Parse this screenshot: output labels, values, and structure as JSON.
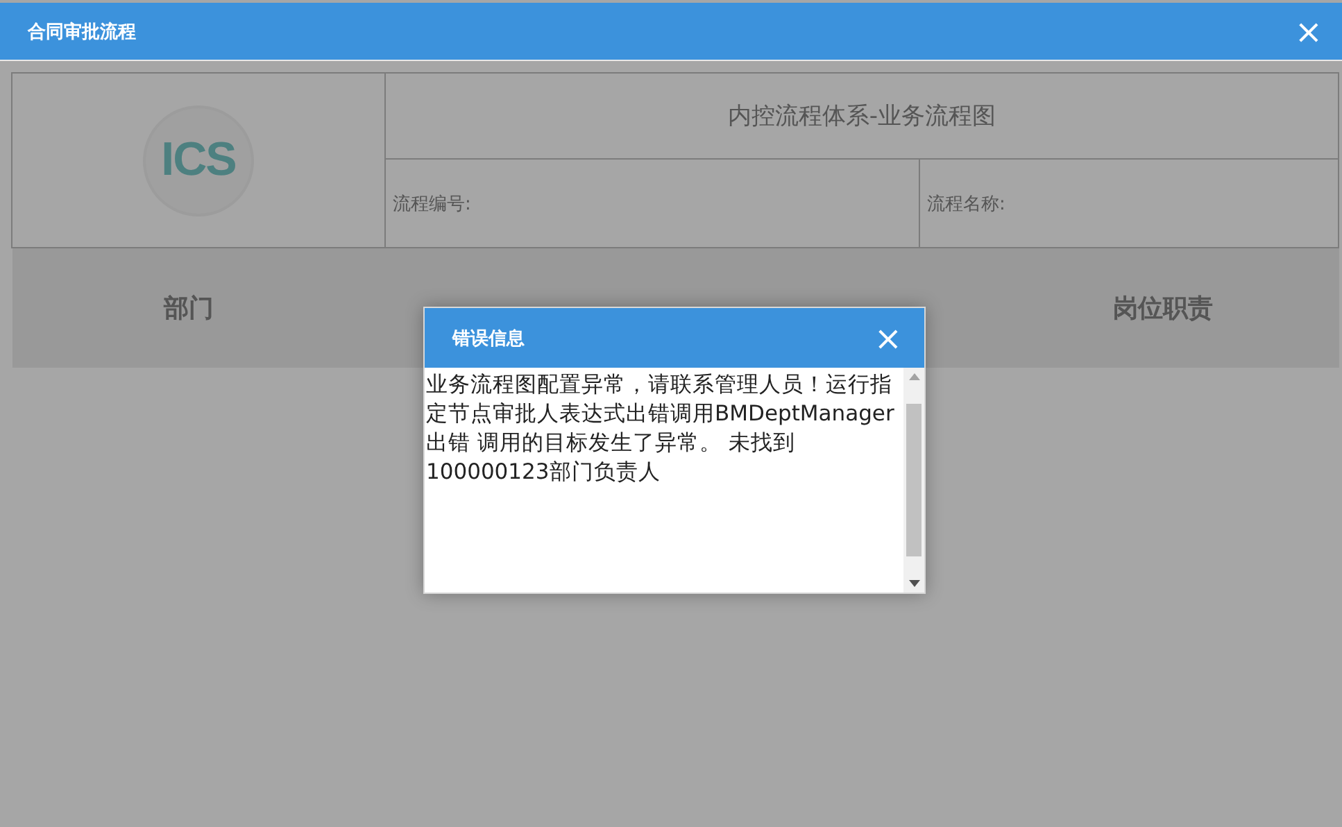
{
  "window": {
    "title": "合同审批流程",
    "close": "×"
  },
  "header": {
    "logo": "ICS",
    "title": "内控流程体系-业务流程图",
    "fields": [
      {
        "label": "流程编号:"
      },
      {
        "label": "流程名称:"
      }
    ]
  },
  "columns": [
    "部门",
    "岗位职责"
  ],
  "dialog": {
    "title": "错误信息",
    "close": "×",
    "message": "业务流程图配置异常，请联系管理人员！运行指定节点审批人表达式出错调用BMDeptManager 出错 调用的目标发生了异常。 未找到100000123部门负责人"
  }
}
